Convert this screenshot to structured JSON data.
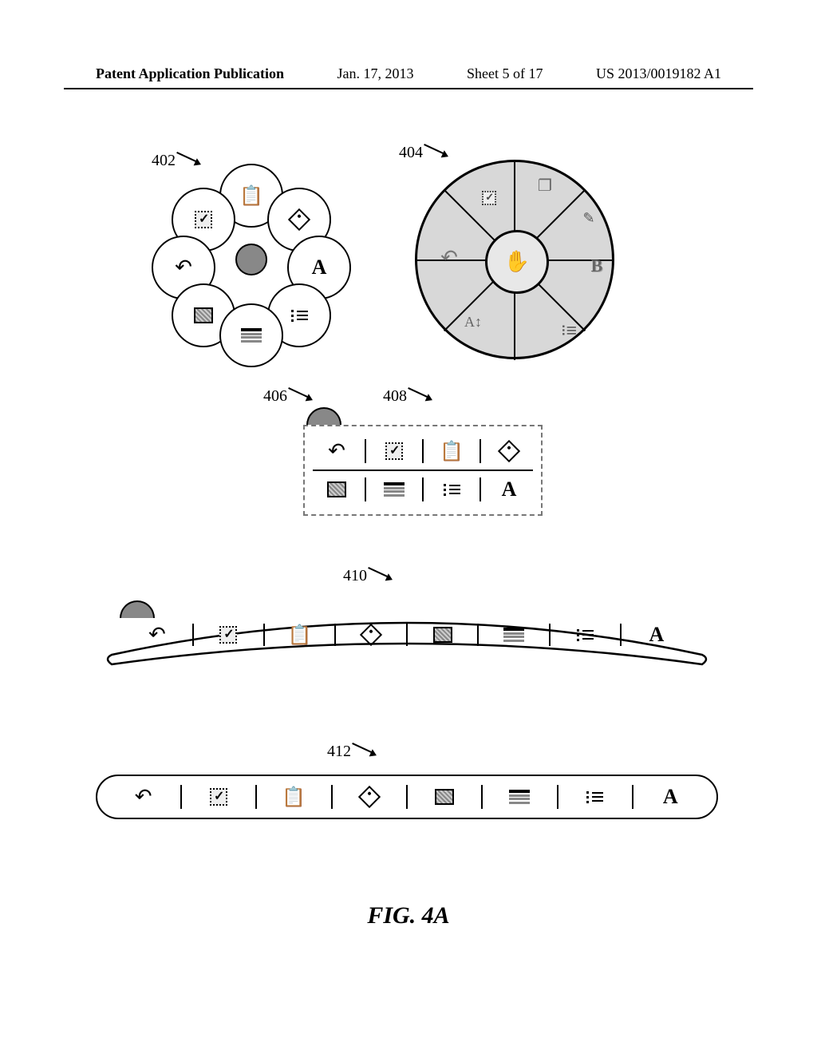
{
  "header": {
    "left": "Patent Application Publication",
    "date": "Jan. 17, 2013",
    "sheet": "Sheet 5 of 17",
    "pubno": "US 2013/0019182 A1"
  },
  "refs": {
    "r402": "402",
    "r404": "404",
    "r406": "406",
    "r408": "408",
    "r410": "410",
    "r412": "412"
  },
  "icons": {
    "undo": "↶",
    "clipboard": "📋",
    "hand": "✋",
    "copy": "❐",
    "brush": "✎",
    "A": "A",
    "B": "B",
    "Aarrows": "A↕"
  },
  "figure_label": "FIG. 4A",
  "menu_items": [
    "undo",
    "check",
    "clipboard",
    "tag",
    "image",
    "lines",
    "bullets",
    "A"
  ]
}
